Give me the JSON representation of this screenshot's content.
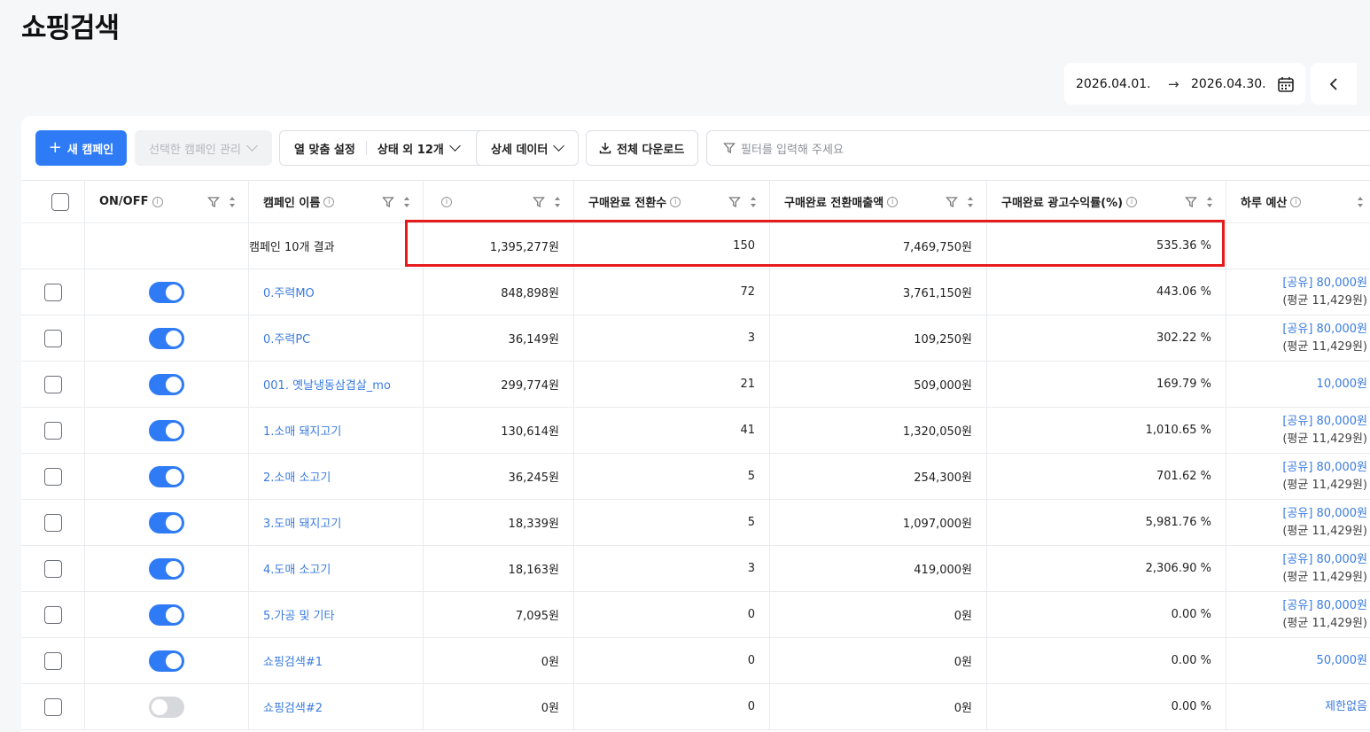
{
  "page_title": "쇼핑검색",
  "date_range": {
    "start": "2026.04.01.",
    "end": "2026.04.30."
  },
  "toolbar": {
    "new_campaign": "새 캠페인",
    "manage_selected": "선택한 캠페인 관리",
    "columns_label": "열 맞춤 설정",
    "columns_value": "상태 외 12개",
    "detail_data": "상세 데이터",
    "download_all": "전체 다운로드",
    "filter_placeholder": "필터를 입력해 주세요"
  },
  "columns": {
    "onoff": "ON/OFF",
    "name": "캠페인 이름",
    "conversions": "구매완료 전환수",
    "revenue": "구매완료 전환매출액",
    "roas": "구매완료 광고수익률(%)",
    "budget": "하루 예산"
  },
  "summary": {
    "label": "캠페인 10개 결과",
    "cost": "1,395,277원",
    "conversions": "150",
    "revenue": "7,469,750원",
    "roas": "535.36 %"
  },
  "rows": [
    {
      "on": true,
      "name": "0.주력MO",
      "cost": "848,898원",
      "conversions": "72",
      "revenue": "3,761,150원",
      "roas": "443.06 %",
      "budget": "[공유] 80,000원",
      "budget_avg": "(평균 11,429원)"
    },
    {
      "on": true,
      "name": "0.주력PC",
      "cost": "36,149원",
      "conversions": "3",
      "revenue": "109,250원",
      "roas": "302.22 %",
      "budget": "[공유] 80,000원",
      "budget_avg": "(평균 11,429원)"
    },
    {
      "on": true,
      "name": "001. 옛날냉동삼겹살_mo",
      "cost": "299,774원",
      "conversions": "21",
      "revenue": "509,000원",
      "roas": "169.79 %",
      "budget": "10,000원",
      "budget_avg": ""
    },
    {
      "on": true,
      "name": "1.소매 돼지고기",
      "cost": "130,614원",
      "conversions": "41",
      "revenue": "1,320,050원",
      "roas": "1,010.65 %",
      "budget": "[공유] 80,000원",
      "budget_avg": "(평균 11,429원)"
    },
    {
      "on": true,
      "name": "2.소매 소고기",
      "cost": "36,245원",
      "conversions": "5",
      "revenue": "254,300원",
      "roas": "701.62 %",
      "budget": "[공유] 80,000원",
      "budget_avg": "(평균 11,429원)"
    },
    {
      "on": true,
      "name": "3.도매 돼지고기",
      "cost": "18,339원",
      "conversions": "5",
      "revenue": "1,097,000원",
      "roas": "5,981.76 %",
      "budget": "[공유] 80,000원",
      "budget_avg": "(평균 11,429원)"
    },
    {
      "on": true,
      "name": "4.도매 소고기",
      "cost": "18,163원",
      "conversions": "3",
      "revenue": "419,000원",
      "roas": "2,306.90 %",
      "budget": "[공유] 80,000원",
      "budget_avg": "(평균 11,429원)"
    },
    {
      "on": true,
      "name": "5.가공 및 기타",
      "cost": "7,095원",
      "conversions": "0",
      "revenue": "0원",
      "roas": "0.00 %",
      "budget": "[공유] 80,000원",
      "budget_avg": "(평균 11,429원)"
    },
    {
      "on": true,
      "name": "쇼핑검색#1",
      "cost": "0원",
      "conversions": "0",
      "revenue": "0원",
      "roas": "0.00 %",
      "budget": "50,000원",
      "budget_avg": ""
    },
    {
      "on": false,
      "name": "쇼핑검색#2",
      "cost": "0원",
      "conversions": "0",
      "revenue": "0원",
      "roas": "0.00 %",
      "budget": "제한없음",
      "budget_avg": ""
    }
  ]
}
